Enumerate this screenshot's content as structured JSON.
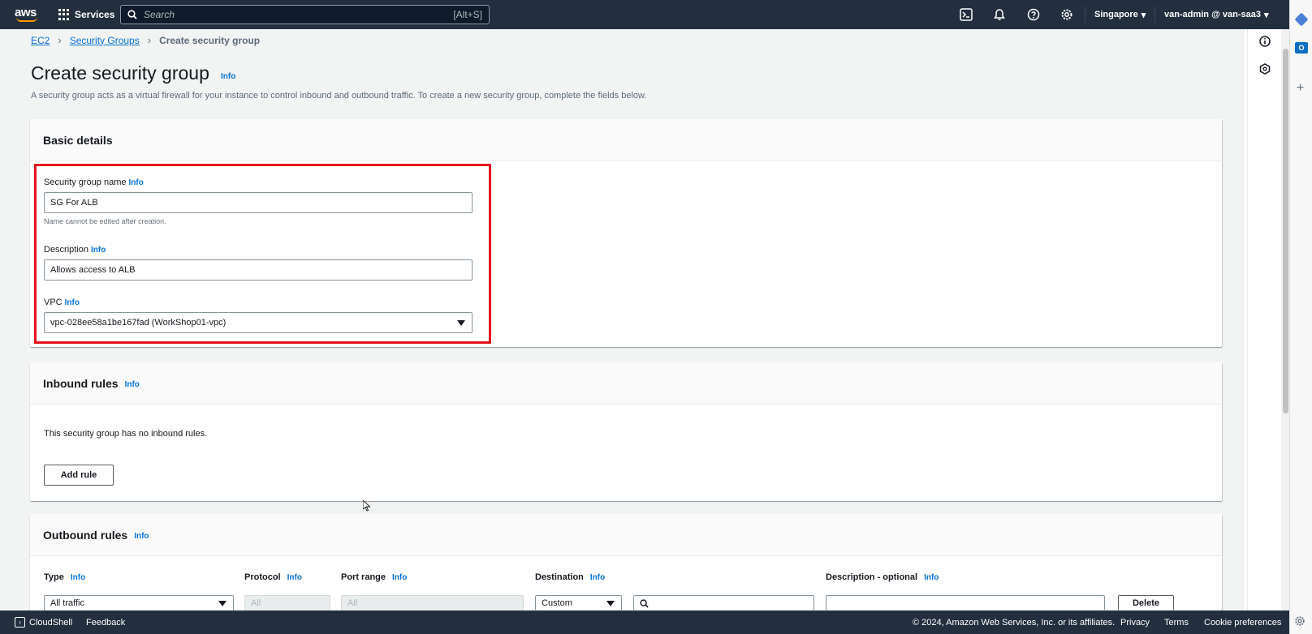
{
  "topnav": {
    "logo": "aws",
    "services_label": "Services",
    "search_placeholder": "Search",
    "search_shortcut": "[Alt+S]",
    "region": "Singapore",
    "account": "van-admin @ van-saa3"
  },
  "breadcrumb": {
    "items": [
      "EC2",
      "Security Groups"
    ],
    "current": "Create security group"
  },
  "page": {
    "title": "Create security group",
    "info": "Info",
    "description": "A security group acts as a virtual firewall for your instance to control inbound and outbound traffic. To create a new security group, complete the fields below."
  },
  "basic_details": {
    "heading": "Basic details",
    "name_label": "Security group name",
    "name_info": "Info",
    "name_value": "SG For ALB",
    "name_hint": "Name cannot be edited after creation.",
    "desc_label": "Description",
    "desc_info": "Info",
    "desc_value": "Allows access to ALB",
    "vpc_label": "VPC",
    "vpc_info": "Info",
    "vpc_value": "vpc-028ee58a1be167fad (WorkShop01-vpc)"
  },
  "inbound": {
    "heading": "Inbound rules",
    "info": "Info",
    "empty_text": "This security group has no inbound rules.",
    "add_rule": "Add rule"
  },
  "outbound": {
    "heading": "Outbound rules",
    "info": "Info",
    "columns": [
      {
        "label": "Type",
        "info": "Info"
      },
      {
        "label": "Protocol",
        "info": "Info"
      },
      {
        "label": "Port range",
        "info": "Info"
      },
      {
        "label": "Destination",
        "info": "Info"
      },
      {
        "label": "Description - optional",
        "info": "Info"
      }
    ],
    "row": {
      "type": "All traffic",
      "protocol": "All",
      "port_range": "All",
      "destination": "Custom",
      "delete": "Delete"
    }
  },
  "footer": {
    "cloudshell": "CloudShell",
    "feedback": "Feedback",
    "copyright": "© 2024, Amazon Web Services, Inc. or its affiliates.",
    "privacy": "Privacy",
    "terms": "Terms",
    "cookies": "Cookie preferences"
  },
  "colors": {
    "nav_bg": "#232f3e",
    "link": "#0972d3",
    "highlight": "#e3141f",
    "aws_orange": "#ff9900"
  }
}
